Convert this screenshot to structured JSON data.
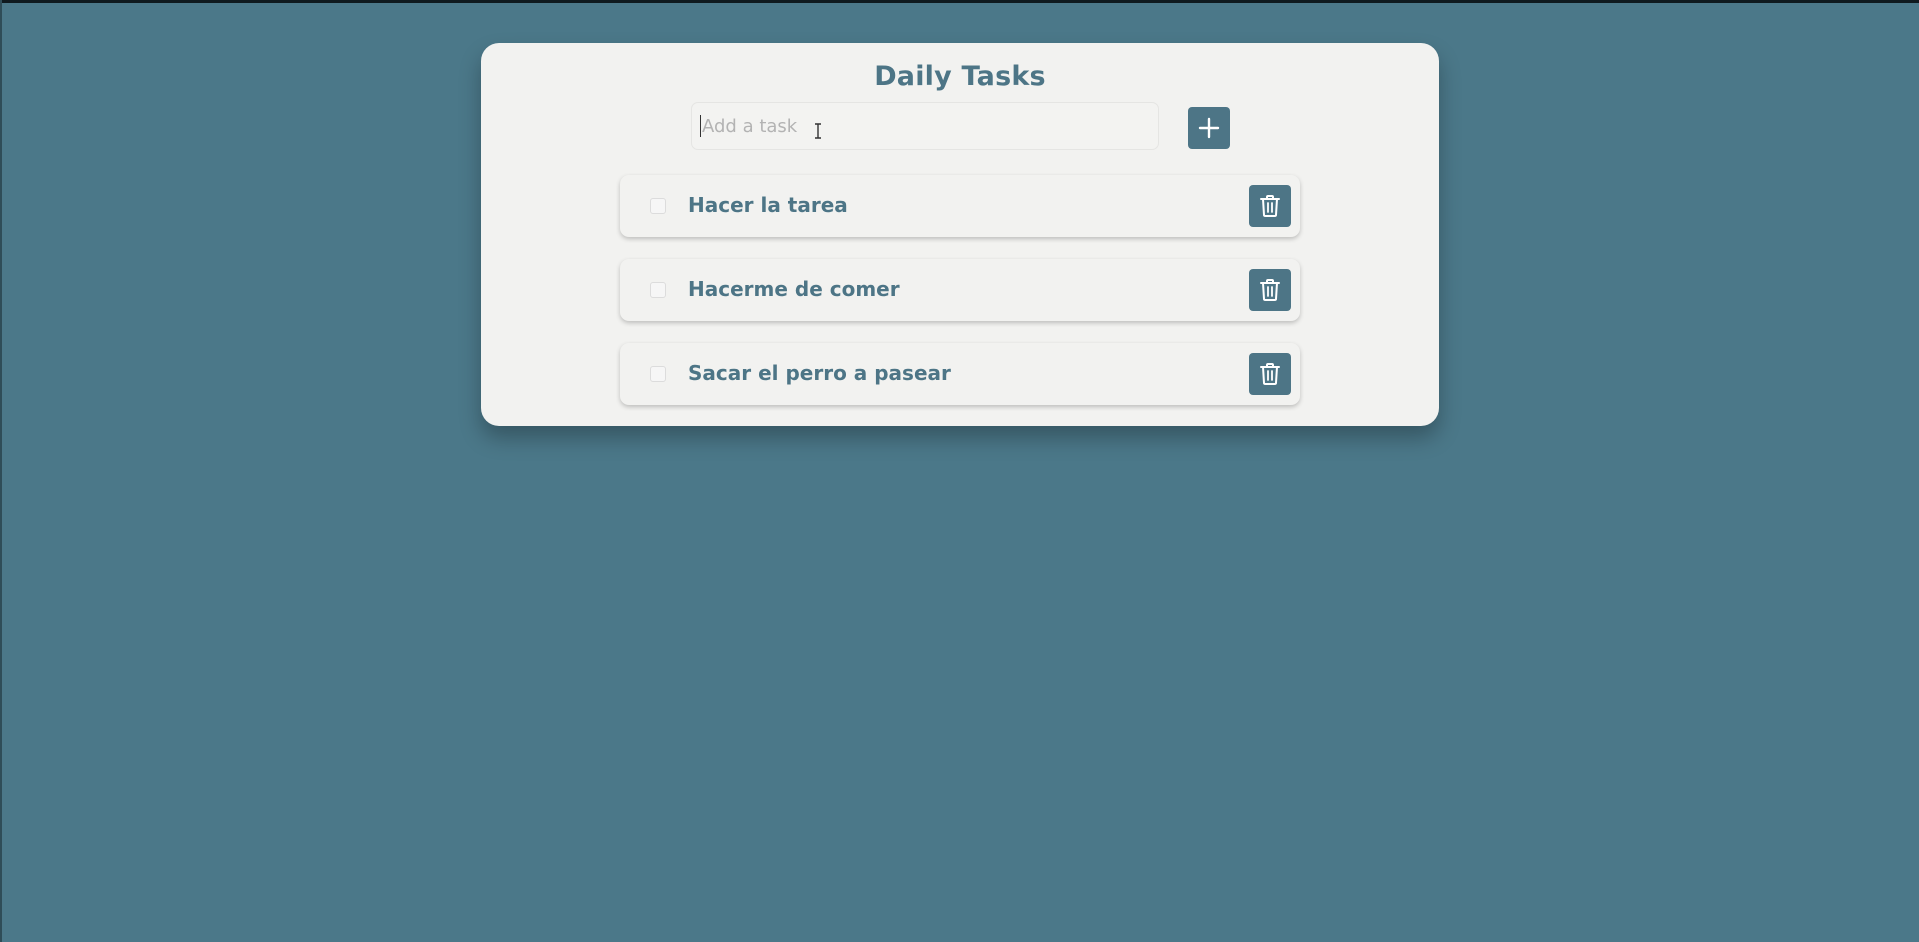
{
  "app": {
    "title": "Daily Tasks"
  },
  "input": {
    "placeholder": "Add a task",
    "value": ""
  },
  "add_button": {
    "icon": "plus-icon"
  },
  "tasks": [
    {
      "label": "Hacer la tarea",
      "checked": false,
      "delete_icon": "trash-icon"
    },
    {
      "label": "Hacerme de comer",
      "checked": false,
      "delete_icon": "trash-icon"
    },
    {
      "label": "Sacar el perro a pasear",
      "checked": false,
      "delete_icon": "trash-icon"
    }
  ],
  "colors": {
    "background": "#4b7889",
    "card": "#f2f2f0",
    "accent": "#4d7586",
    "placeholder": "#b3b3b3"
  }
}
